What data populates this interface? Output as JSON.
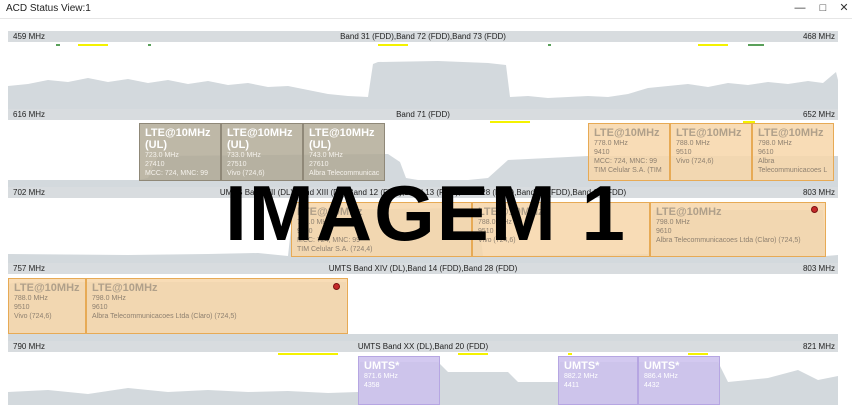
{
  "window": {
    "title": "ACD Status View:1",
    "minimize_glyph": "—",
    "maximize_glyph": "□",
    "close_glyph": "✕"
  },
  "overlay_text": "IMAGEM 1",
  "bands": [
    {
      "freq_left": "459 MHz",
      "freq_right": "468 MHz",
      "name": "Band 31 (FDD),Band 72 (FDD),Band 73 (FDD)",
      "cards": []
    },
    {
      "freq_left": "616 MHz",
      "freq_right": "652 MHz",
      "name": "Band 71 (FDD)",
      "cards": [
        {
          "title": "LTE@10MHz\n(UL)",
          "lines": [
            "723.0 MHz",
            "27410",
            "MCC: 724, MNC: 99"
          ],
          "style": "gray"
        },
        {
          "title": "LTE@10MHz\n(UL)",
          "lines": [
            "733.0 MHz",
            "27510",
            "Vivo (724,6)"
          ],
          "style": "gray"
        },
        {
          "title": "LTE@10MHz\n(UL)",
          "lines": [
            "743.0 MHz",
            "27610",
            "Albra Telecommunicac"
          ],
          "style": "gray"
        },
        {
          "title": "LTE@10MHz",
          "lines": [
            "778.0 MHz",
            "9410",
            "MCC: 724, MNC: 99",
            "TIM Celular S.A. (TIM"
          ],
          "style": "orange"
        },
        {
          "title": "LTE@10MHz",
          "lines": [
            "788.0 MHz",
            "9510",
            "Vivo (724,6)"
          ],
          "style": "orange"
        },
        {
          "title": "LTE@10MHz",
          "lines": [
            "798.0 MHz",
            "9610",
            "Albra",
            "Telecommunicacoes L"
          ],
          "style": "orange"
        }
      ]
    },
    {
      "freq_left": "702 MHz",
      "freq_right": "803 MHz",
      "name": "UMTS Band XII (DL),Band XIII (DL),Band 12 (FDD),Band 13 (FDD),Band 28 (FDD),Band 67 (FDD),Band 68 (FDD)",
      "cards": [
        {
          "title": "LTE@10MHz",
          "lines": [
            "778.0 MHz",
            "9410",
            "MCC: 724, MNC: 99",
            "TIM Celular S.A. (724,4)"
          ],
          "style": "orange"
        },
        {
          "title": "LTE@10MHz",
          "lines": [
            "788.0 MHz",
            "9510",
            "Vivo (724,6)"
          ],
          "style": "orange"
        },
        {
          "title": "LTE@10MHz",
          "lines": [
            "798.0 MHz",
            "9610",
            "Albra Telecommunicacoes Ltda (Claro) (724,5)"
          ],
          "style": "orange"
        }
      ]
    },
    {
      "freq_left": "757 MHz",
      "freq_right": "803 MHz",
      "name": "UMTS Band XIV (DL),Band 14 (FDD),Band 28 (FDD)",
      "cards": [
        {
          "title": "LTE@10MHz",
          "lines": [
            "788.0 MHz",
            "9510",
            "Vivo (724,6)"
          ],
          "style": "orange"
        },
        {
          "title": "LTE@10MHz",
          "lines": [
            "798.0 MHz",
            "9610",
            "Albra Telecommunicacoes Ltda (Claro) (724,5)"
          ],
          "style": "orange"
        }
      ]
    },
    {
      "freq_left": "790 MHz",
      "freq_right": "821 MHz",
      "name": "UMTS Band XX (DL),Band 20 (FDD)",
      "cards": [
        {
          "title": "UMTS*",
          "lines": [
            "871.6 MHz",
            "4358"
          ],
          "style": "purple"
        },
        {
          "title": "UMTS*",
          "lines": [
            "882.2 MHz",
            "4411"
          ],
          "style": "purple"
        },
        {
          "title": "UMTS*",
          "lines": [
            "886.4 MHz",
            "4432"
          ],
          "style": "purple"
        }
      ]
    }
  ],
  "colors": {
    "header_bg": "#d8dcdf",
    "spectrum_fill": "#d3d9dd",
    "lte_ul_card": "#b0a894",
    "lte_dl_card": "#f7d6aa",
    "umts_card": "#ccc0ee",
    "marker_yellow": "#f4f200",
    "marker_green": "#5aa05a",
    "alert_red": "#c42a2a",
    "overlay_text": "#000000"
  },
  "icons": {
    "alert": "red-alert-circle-icon"
  }
}
